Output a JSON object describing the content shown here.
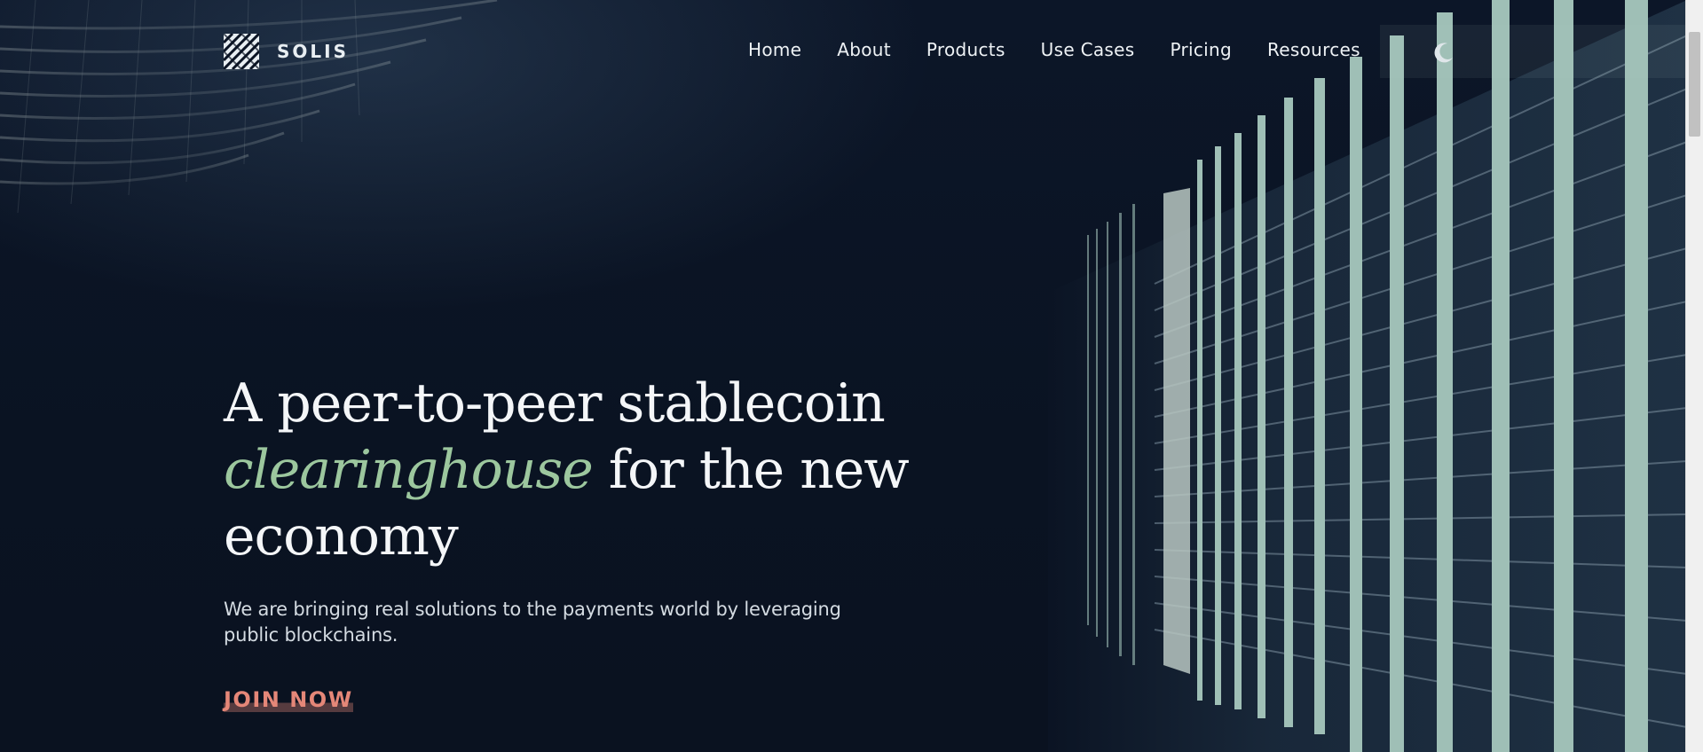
{
  "brand": {
    "name": "SOLIS",
    "logo_icon": "woven-square-logo-icon"
  },
  "nav": {
    "items": [
      {
        "label": "Home"
      },
      {
        "label": "About"
      },
      {
        "label": "Products"
      },
      {
        "label": "Use Cases"
      },
      {
        "label": "Pricing"
      },
      {
        "label": "Resources"
      }
    ],
    "theme_toggle_icon": "moon-icon"
  },
  "hero": {
    "headline_part1": "A peer-to-peer stablecoin",
    "headline_accent": "clearinghouse",
    "headline_part2": " for the new economy",
    "subtext": "We are bringing real solutions to the payments world by leveraging public blockchains.",
    "cta_label": "JOIN NOW"
  },
  "colors": {
    "background": "#0b1424",
    "accent_green": "#9cc79e",
    "cta_coral": "#e58778",
    "text": "#f4f6f8"
  }
}
